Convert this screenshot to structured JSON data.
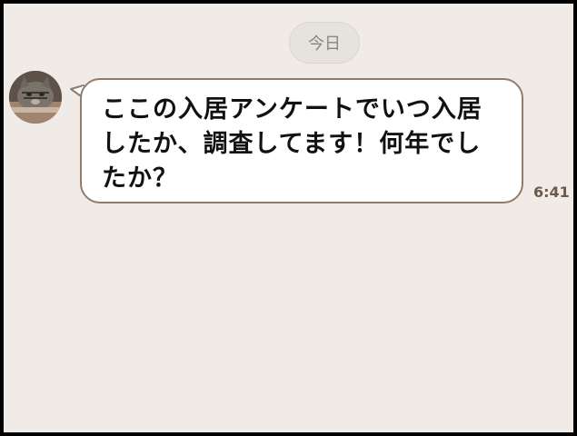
{
  "chat": {
    "date_label": "今日",
    "messages": [
      {
        "sender": "other",
        "avatar_icon": "cat-avatar",
        "text": "ここの入居アンケートでいつ入居したか、調査してます！何年でしたか？",
        "time": "6:41"
      }
    ]
  },
  "colors": {
    "background": "#f0ebe6",
    "bubble": "#ffffff",
    "bubble_border": "#8f7c6c",
    "time": "#6a5a4c"
  }
}
